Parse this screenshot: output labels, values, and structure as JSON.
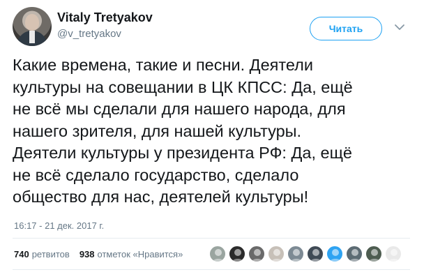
{
  "author": {
    "display_name": "Vitaly Tretyakov",
    "handle": "@v_tretyakov",
    "avatar_icon": "person-portrait-icon"
  },
  "follow_label": "Читать",
  "tweet": {
    "text": "Какие времена, такие и песни. Деятели\nкультуры на совещании в ЦК КПСС: Да, ещё\nне всё мы сделали для нашего народа, для\nнашего зрителя, для нашей культуры.\nДеятели культуры у президента РФ: Да, ещё\nне всё сделало государство, сделало\nобщество для нас, деятелей культуры!",
    "timestamp": "16:17 - 21 дек. 2017 г."
  },
  "stats": {
    "retweets_count": "740",
    "retweets_label": "ретвитов",
    "likes_count": "938",
    "likes_label": "отметок «Нравится»"
  },
  "likers": [
    {
      "icon": "user-avatar-icon",
      "color": "#9aa5a0"
    },
    {
      "icon": "user-avatar-icon",
      "color": "#2b2b2b"
    },
    {
      "icon": "user-avatar-icon",
      "color": "#6a6a6a"
    },
    {
      "icon": "user-avatar-icon",
      "color": "#c7c0b8"
    },
    {
      "icon": "default-egg-avatar-icon",
      "color": "#7d8a94"
    },
    {
      "icon": "user-avatar-icon",
      "color": "#3f4a55"
    },
    {
      "icon": "user-avatar-icon",
      "color": "#2ea3f2"
    },
    {
      "icon": "user-avatar-icon",
      "color": "#5c6b73"
    },
    {
      "icon": "user-avatar-icon",
      "color": "#4d5c50"
    },
    {
      "icon": "user-avatar-icon",
      "color": "#e9e9e9"
    }
  ],
  "colors": {
    "accent": "#1da1f2",
    "secondary_text": "#657786",
    "divider": "#e6ecf0"
  }
}
